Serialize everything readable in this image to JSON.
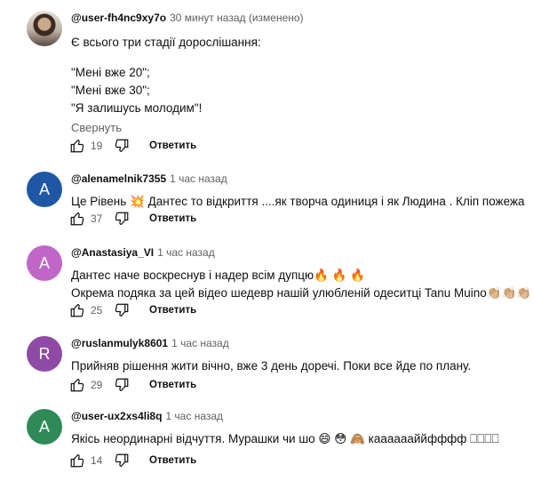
{
  "comments": [
    {
      "author": "@user-fh4nc9xy7o",
      "time": "30 минут назад (изменено)",
      "lines": [
        "Є всього три стадії дорослішання:",
        "",
        "\"Мені вже 20\";",
        "\"Мені вже 30\";",
        "\"Я залишусь молодим\"!"
      ],
      "collapse": "Свернуть",
      "likes": "19",
      "reply": "Ответить",
      "avatar_type": "photo"
    },
    {
      "author": "@alenamelnik7355",
      "time": "1 час назад",
      "lines": [
        "Це Рівень 💥 Дантес то відкриття ....як творча одиниця і як Людина .  Кліп пожежа"
      ],
      "likes": "37",
      "reply": "Ответить",
      "avatar_letter": "A",
      "avatar_color": "#1f57a4"
    },
    {
      "author": "@Anastasiya_VI",
      "time": "1 час назад",
      "lines": [
        "Дантес наче воскреснув і надер всім дупцю🔥 🔥 🔥",
        "Окрема подяка за цей відео шедевр нашій улюбленій одеситці Tanu Muino👏🏼👏🏼👏🏼"
      ],
      "likes": "25",
      "reply": "Ответить",
      "avatar_letter": "A",
      "avatar_color": "#c066c7"
    },
    {
      "author": "@ruslanmulyk8601",
      "time": "1 час назад",
      "lines": [
        "Прийняв рішення жити вічно, вже 3 день доречі.  Поки все йде по плану."
      ],
      "likes": "29",
      "reply": "Ответить",
      "avatar_letter": "R",
      "avatar_color": "#8e4aa4"
    },
    {
      "author": "@user-ux2xs4li8q",
      "time": "1 час назад",
      "lines": [
        "Якісь неординарні відчуття. Мурашки чи шо 😄 😳 🙈  кааааааййфффф ⎕⎕⎕⎕"
      ],
      "likes": "14",
      "reply": "Ответить",
      "avatar_letter": "A",
      "avatar_color": "#2e8b57"
    }
  ]
}
